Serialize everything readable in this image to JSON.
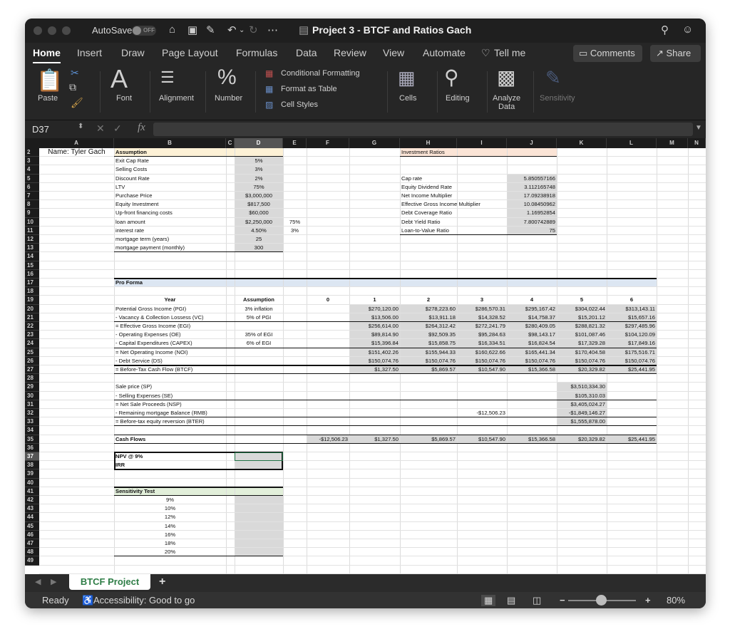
{
  "app": {
    "autosave_label": "AutoSave",
    "autosave_state": "OFF",
    "title": "Project 3 - BTCF and Ratios Gach"
  },
  "tabs": [
    "Home",
    "Insert",
    "Draw",
    "Page Layout",
    "Formulas",
    "Data",
    "Review",
    "View",
    "Automate"
  ],
  "active_tab": "Home",
  "tell_me": "Tell me",
  "comments_label": "Comments",
  "share_label": "Share",
  "ribbon": {
    "paste": "Paste",
    "font": "Font",
    "alignment": "Alignment",
    "number": "Number",
    "conditional_formatting": "Conditional Formatting",
    "format_as_table": "Format as Table",
    "cell_styles": "Cell Styles",
    "cells": "Cells",
    "editing": "Editing",
    "analyze_data_line1": "Analyze",
    "analyze_data_line2": "Data",
    "sensitivity": "Sensitivity"
  },
  "formula_bar": {
    "name_box": "D37",
    "fx": "fx",
    "formula": ""
  },
  "columns": [
    "A",
    "B",
    "C",
    "D",
    "E",
    "F",
    "G",
    "H",
    "I",
    "J",
    "K",
    "L",
    "M",
    "N"
  ],
  "selected_column": "D",
  "rows": [
    "2",
    "3",
    "4",
    "5",
    "6",
    "7",
    "8",
    "9",
    "10",
    "11",
    "12",
    "13",
    "14",
    "15",
    "16",
    "17",
    "18",
    "19",
    "20",
    "21",
    "22",
    "23",
    "24",
    "25",
    "26",
    "27",
    "28",
    "29",
    "30",
    "31",
    "32",
    "33",
    "34",
    "35",
    "36",
    "37",
    "38",
    "39",
    "40",
    "41",
    "42",
    "43",
    "44",
    "45",
    "46",
    "47",
    "48",
    "49"
  ],
  "selected_row": "37",
  "sheet": {
    "name_cell": "Name: Tyler Gach",
    "assumption_header": "Assumption",
    "assumptions": [
      {
        "label": "Exit Cap Rate",
        "value": "5%",
        "extra": ""
      },
      {
        "label": "Selling Costs",
        "value": "3%",
        "extra": ""
      },
      {
        "label": "Discount Rate",
        "value": "2%",
        "extra": ""
      },
      {
        "label": "LTV",
        "value": "75%",
        "extra": ""
      },
      {
        "label": "Purchase Price",
        "value": "$3,000,000",
        "extra": ""
      },
      {
        "label": "Equity Investment",
        "value": "$817,500",
        "extra": ""
      },
      {
        "label": "Up-front financing costs",
        "value": "$60,000",
        "extra": ""
      },
      {
        "label": "loan amount",
        "value": "$2,250,000",
        "extra": "75%"
      },
      {
        "label": "interest rate",
        "value": "4.50%",
        "extra": "3%"
      },
      {
        "label": "mortgage term (years)",
        "value": "25",
        "extra": ""
      },
      {
        "label": "mortgage payment (monthly)",
        "value": "300",
        "extra": ""
      }
    ],
    "ratios_header": "Investment Ratios",
    "ratios": [
      {
        "label": "Cap rate",
        "value": "5.850557166"
      },
      {
        "label": "Equity Dividend Rate",
        "value": "3.112165748"
      },
      {
        "label": "Net Income Multiplier",
        "value": "17.09238918"
      },
      {
        "label": "Effective Gross Income Multiplier",
        "value": "10.08450962"
      },
      {
        "label": "Debt Coverage Ratio",
        "value": "1.16952854"
      },
      {
        "label": "Debt Yield Ratio",
        "value": "7.800742889"
      },
      {
        "label": "Loan-to-Value Ratio",
        "value": "75"
      }
    ],
    "pro_forma_header": "Pro Forma",
    "pf_year_label": "Year",
    "pf_assumption_label": "Assumption",
    "pf_years": [
      "0",
      "1",
      "2",
      "3",
      "4",
      "5",
      "6"
    ],
    "pf_rows": [
      {
        "label": "Potential Gross Income (PGI)",
        "assumption": "3% inflation",
        "values": [
          "$270,120.00",
          "$278,223.60",
          "$286,570.31",
          "$295,167.42",
          "$304,022.44",
          "$313,143.11"
        ]
      },
      {
        "label": "- Vacancy & Collection Lossess (VC)",
        "assumption": "5% of PGI",
        "values": [
          "$13,506.00",
          "$13,911.18",
          "$14,328.52",
          "$14,758.37",
          "$15,201.12",
          "$15,657.16"
        ]
      },
      {
        "label": "= Effective Gross Income (EGI)",
        "assumption": "",
        "values": [
          "$256,614.00",
          "$264,312.42",
          "$272,241.79",
          "$280,409.05",
          "$288,821.32",
          "$297,485.96"
        ]
      },
      {
        "label": "- Operating Expenses (OE)",
        "assumption": "35% of EGI",
        "values": [
          "$89,814.90",
          "$92,509.35",
          "$95,284.63",
          "$98,143.17",
          "$101,087.46",
          "$104,120.09"
        ]
      },
      {
        "label": "- Capital Expenditures (CAPEX)",
        "assumption": "6% of EGI",
        "values": [
          "$15,396.84",
          "$15,858.75",
          "$16,334.51",
          "$16,824.54",
          "$17,329.28",
          "$17,849.16"
        ]
      },
      {
        "label": "= Net Operating Income (NOI)",
        "assumption": "",
        "values": [
          "$151,402.26",
          "$155,944.33",
          "$160,622.66",
          "$165,441.34",
          "$170,404.58",
          "$175,516.71"
        ]
      },
      {
        "label": "- Debt Service (DS)",
        "assumption": "",
        "values": [
          "$150,074.76",
          "$150,074.76",
          "$150,074.76",
          "$150,074.76",
          "$150,074.76",
          "$150,074.76"
        ]
      },
      {
        "label": "= Before-Tax Cash Flow (BTCF)",
        "assumption": "",
        "values": [
          "$1,327.50",
          "$5,869.57",
          "$10,547.90",
          "$15,366.58",
          "$20,329.82",
          "$25,441.95"
        ]
      }
    ],
    "sale_rows": [
      {
        "label": "Sale price (SP)",
        "i_value": "",
        "k_value": "$3,510,334.30"
      },
      {
        "label": "- Selling Expenses (SE)",
        "i_value": "",
        "k_value": "$105,310.03"
      },
      {
        "label": "= Net Sale Proceeds (NSP)",
        "i_value": "",
        "k_value": "$3,405,024.27"
      },
      {
        "label": "- Remaining mortgage Balance (RMB)",
        "i_value": "-$12,506.23",
        "k_value": "-$1,849,146.27"
      },
      {
        "label": "= Before-tax equity reversion (BTER)",
        "i_value": "",
        "k_value": "$1,555,878.00"
      }
    ],
    "cash_flows_label": "Cash Flows",
    "cash_flows": [
      "-$12,506.23",
      "$1,327.50",
      "$5,869.57",
      "$10,547.90",
      "$15,366.58",
      "$20,329.82",
      "$25,441.95"
    ],
    "npv_label": "NPV @ 9%",
    "irr_label": "IRR",
    "npv_value": "",
    "irr_value": "",
    "sensitivity_header": "Sensitivity Test",
    "sensitivity_rates": [
      "9%",
      "10%",
      "12%",
      "14%",
      "16%",
      "18%",
      "20%"
    ]
  },
  "sheet_tab": "BTCF Project",
  "add_sheet": "+",
  "status": {
    "ready": "Ready",
    "accessibility": "Accessibility: Good to go",
    "zoom": "80%",
    "zoom_fraction": 0.8
  },
  "colors": {
    "assumption_band": "#fdf1d6",
    "ratios_band": "#fbe4d6",
    "pro_forma_band": "#dce6f2",
    "sensitivity_band": "#e2efda",
    "shade": "#d9d9d9",
    "sheet_tab_text": "#2e7d46"
  }
}
